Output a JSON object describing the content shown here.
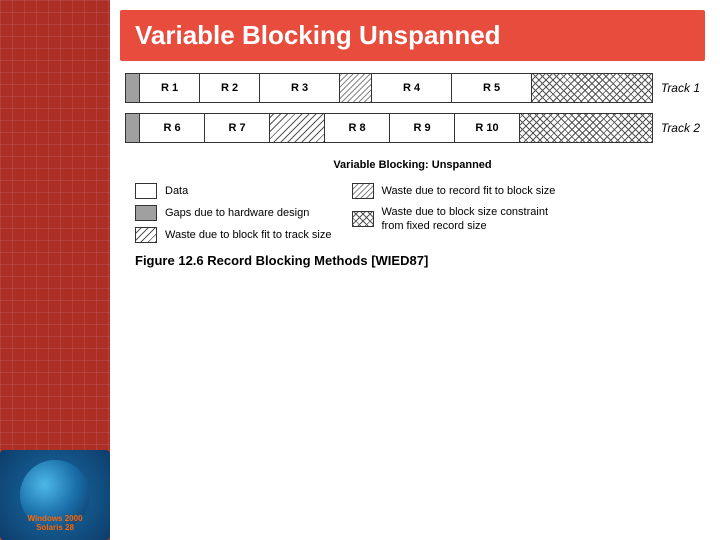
{
  "title": "Variable Blocking Unspanned",
  "track1": {
    "label": "Track 1",
    "blocks": [
      {
        "id": "gap1",
        "type": "gap",
        "label": ""
      },
      {
        "id": "r1",
        "type": "data",
        "label": "R 1"
      },
      {
        "id": "r2",
        "type": "data",
        "label": "R 2"
      },
      {
        "id": "r3",
        "type": "data",
        "label": "R 3"
      },
      {
        "id": "waste1",
        "type": "waste-record",
        "label": ""
      },
      {
        "id": "r4",
        "type": "data",
        "label": "R 4"
      },
      {
        "id": "r5",
        "type": "data",
        "label": "R 5"
      },
      {
        "id": "waste2",
        "type": "waste-block",
        "label": ""
      }
    ]
  },
  "track2": {
    "label": "Track 2",
    "blocks": [
      {
        "id": "gap2",
        "type": "gap",
        "label": ""
      },
      {
        "id": "r6",
        "type": "data",
        "label": "R 6"
      },
      {
        "id": "r7",
        "type": "data",
        "label": "R 7"
      },
      {
        "id": "waste3",
        "type": "waste-track",
        "label": ""
      },
      {
        "id": "r8",
        "type": "data",
        "label": "R 8"
      },
      {
        "id": "r9",
        "type": "data",
        "label": "R 9"
      },
      {
        "id": "r10",
        "type": "data",
        "label": "R 10"
      },
      {
        "id": "waste4",
        "type": "waste-block",
        "label": ""
      }
    ]
  },
  "caption": "Variable Blocking: Unspanned",
  "legend": {
    "left": [
      {
        "type": "data",
        "text": "Data"
      },
      {
        "type": "gap",
        "text": "Gaps due to hardware design"
      },
      {
        "type": "waste-track",
        "text": "Waste due to block fit to track size"
      }
    ],
    "right": [
      {
        "type": "waste-record",
        "text": "Waste due to record fit to block size"
      },
      {
        "type": "waste-block",
        "text": "Waste due to block size constraint\nfrom fixed record size"
      }
    ]
  },
  "figure_caption": "Figure 12.6   Record Blocking Methods [WIED87]"
}
